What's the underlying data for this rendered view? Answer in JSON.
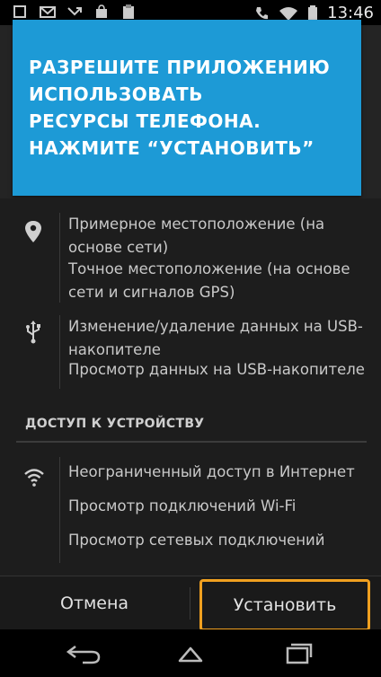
{
  "status_bar": {
    "time": "13:46",
    "left_icons": [
      "notification-icon",
      "gmail-icon",
      "missed-call-icon",
      "shopping-bag-icon",
      "clipboard-icon"
    ],
    "right_icons": [
      "phone-icon",
      "wifi-icon",
      "battery-icon"
    ]
  },
  "overlay": {
    "text": "РАЗРЕШИТЕ ПРИЛОЖЕНИЮ\nИСПОЛЬЗОВАТЬ\nРЕСУРСЫ ТЕЛЕФОНА.\nНАЖМИТЕ  “УСТАНОВИТЬ”",
    "color": "#1d9ad6"
  },
  "permissions": {
    "location": {
      "icon": "location-pin-icon",
      "items": [
        "Примерное местоположение (на основе сети)",
        "Точное местоположение (на основе сети и сигналов GPS)"
      ]
    },
    "storage": {
      "icon": "usb-icon",
      "items": [
        "Изменение/удаление данных на USB-накопителе",
        "Просмотр данных на USB-накопителе"
      ]
    },
    "device_access_header": "ДОСТУП К УСТРОЙСТВУ",
    "network": {
      "icon": "wifi-icon",
      "items": [
        "Неограниченный доступ в Интернет",
        "Просмотр подключений Wi-Fi",
        "Просмотр сетевых подключений"
      ]
    }
  },
  "buttons": {
    "cancel": "Отмена",
    "install": "Установить",
    "highlight_color": "#f0a020"
  },
  "nav_bar": {
    "icons": [
      "back-icon",
      "home-icon",
      "recent-apps-icon"
    ]
  }
}
